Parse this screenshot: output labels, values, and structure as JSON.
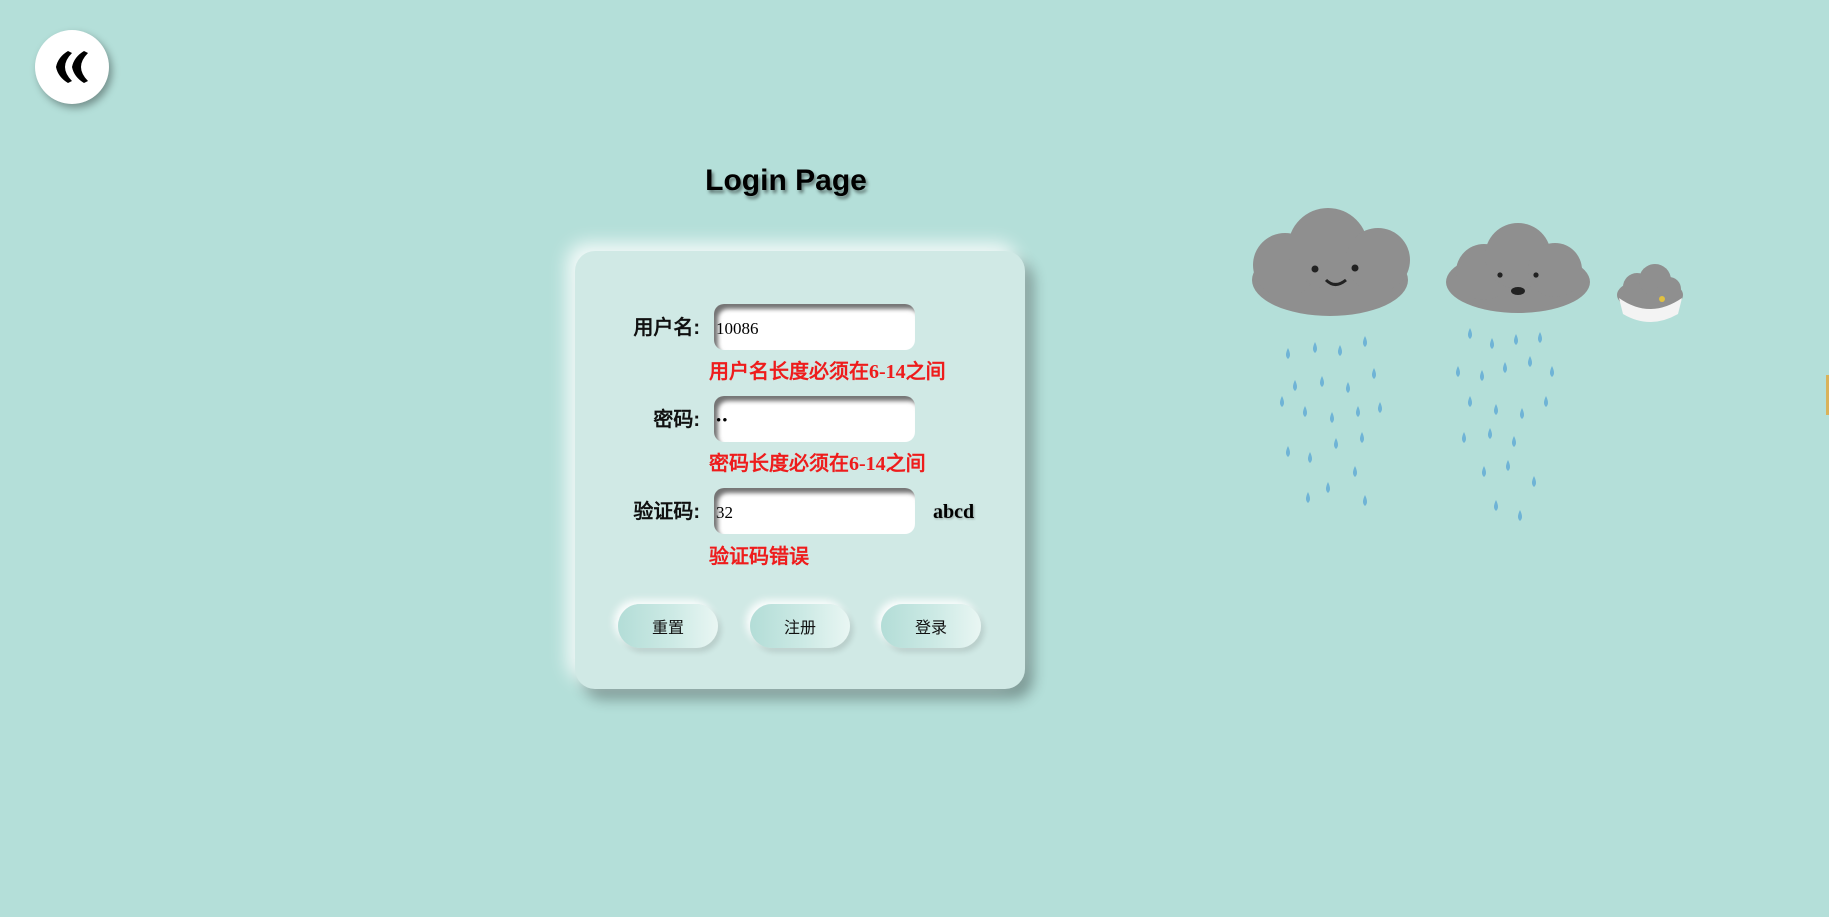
{
  "header": {
    "back_icon": "double-chevron-left-icon",
    "title": "Login Page"
  },
  "form": {
    "username": {
      "label": "用户名:",
      "value": "10086",
      "error": "用户名长度必须在6-14之间"
    },
    "password": {
      "label": "密码:",
      "value": "••",
      "error": "密码长度必须在6-14之间"
    },
    "captcha": {
      "label": "验证码:",
      "value": "32",
      "code": "abcd",
      "error": "验证码错误"
    },
    "buttons": {
      "reset": "重置",
      "register": "注册",
      "login": "登录"
    }
  },
  "decoration": {
    "icon": "rain-clouds-illustration"
  },
  "colors": {
    "background": "#b4dfd9",
    "card": "#d0e9e5",
    "error": "#ee1c1c",
    "cloud": "#8d8d8d",
    "raindrop": "#6fb4d6"
  }
}
